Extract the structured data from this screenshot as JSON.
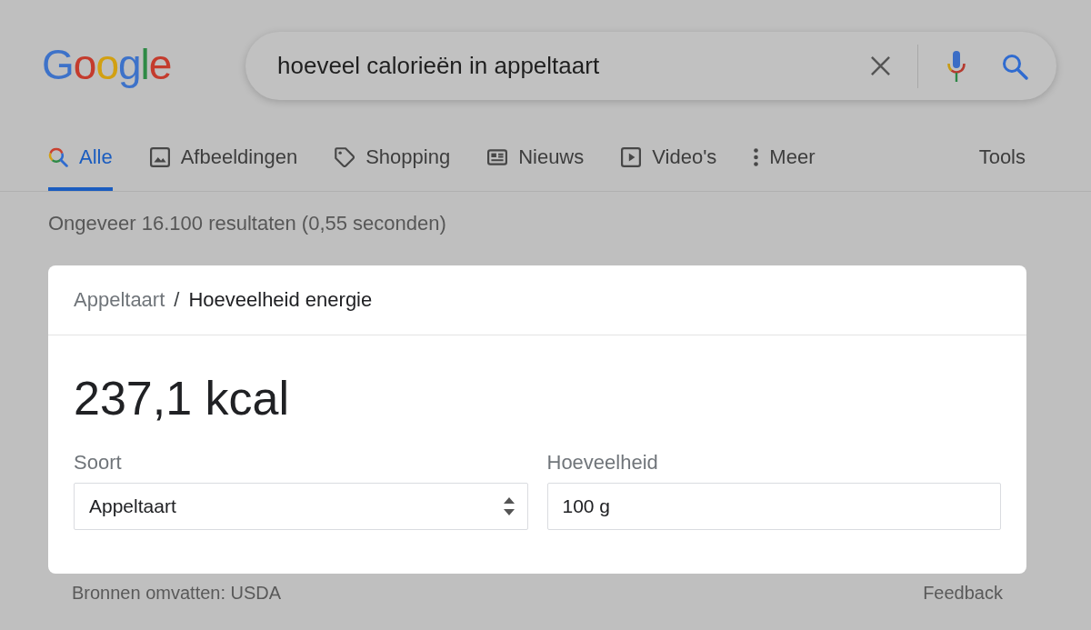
{
  "logo": {
    "text": "Google"
  },
  "search": {
    "value": "hoeveel calorieën in appeltaart"
  },
  "tabs": [
    {
      "kind": "all",
      "label": "Alle",
      "selected": true
    },
    {
      "kind": "images",
      "label": "Afbeeldingen",
      "selected": false
    },
    {
      "kind": "shopping",
      "label": "Shopping",
      "selected": false
    },
    {
      "kind": "news",
      "label": "Nieuws",
      "selected": false
    },
    {
      "kind": "videos",
      "label": "Video's",
      "selected": false
    },
    {
      "kind": "more",
      "label": "Meer",
      "selected": false
    }
  ],
  "tools": {
    "label": "Tools"
  },
  "result_stats": "Ongeveer 16.100 resultaten (0,55 seconden)",
  "card": {
    "breadcrumb": [
      {
        "label": "Appeltaart",
        "selected": false
      },
      {
        "label": "Hoeveelheid energie",
        "selected": true
      }
    ],
    "separator": "/",
    "value": "237,1 kcal",
    "fields": [
      {
        "kind": "select",
        "label": "Soort",
        "value": "Appeltaart"
      },
      {
        "kind": "input",
        "label": "Hoeveelheid",
        "value": "100 g"
      }
    ]
  },
  "footer": {
    "source": "Bronnen omvatten: USDA",
    "feedback": "Feedback"
  }
}
